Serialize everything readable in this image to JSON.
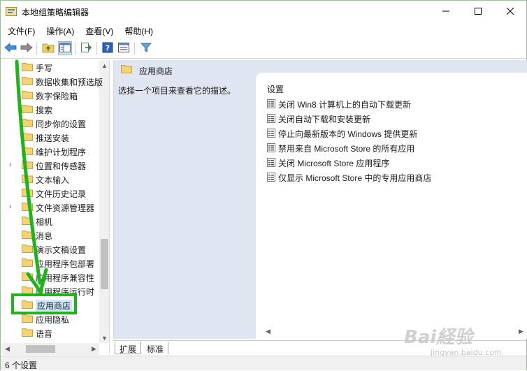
{
  "window": {
    "title": "本地组策略编辑器",
    "controls": {
      "minimize": "minimize-icon",
      "maximize": "maximize-icon",
      "close": "close-icon"
    }
  },
  "menu": [
    "文件(F)",
    "操作(A)",
    "查看(V)",
    "帮助(H)"
  ],
  "toolbar": {
    "icons": [
      "back-arrow-icon",
      "forward-arrow-icon",
      "folder-up-icon",
      "show-hide-tree-icon",
      "export-list-icon",
      "help-icon",
      "properties-icon",
      "filter-icon"
    ]
  },
  "tree": {
    "items": [
      {
        "label": "手写",
        "expandable": false
      },
      {
        "label": "数据收集和预选版",
        "expandable": false
      },
      {
        "label": "数字保险箱",
        "expandable": false
      },
      {
        "label": "搜索",
        "expandable": false
      },
      {
        "label": "同步你的设置",
        "expandable": false
      },
      {
        "label": "推送安装",
        "expandable": false
      },
      {
        "label": "维护计划程序",
        "expandable": false
      },
      {
        "label": "位置和传感器",
        "expandable": true
      },
      {
        "label": "文本输入",
        "expandable": false
      },
      {
        "label": "文件历史记录",
        "expandable": false
      },
      {
        "label": "文件资源管理器",
        "expandable": true
      },
      {
        "label": "相机",
        "expandable": false
      },
      {
        "label": "消息",
        "expandable": false
      },
      {
        "label": "演示文稿设置",
        "expandable": false
      },
      {
        "label": "应用程序包部署",
        "expandable": false
      },
      {
        "label": "应用程序兼容性",
        "expandable": false
      },
      {
        "label": "应用程序运行时",
        "expandable": false
      },
      {
        "label": "应用商店",
        "expandable": false,
        "selected": true
      },
      {
        "label": "应用隐私",
        "expandable": false
      },
      {
        "label": "语音",
        "expandable": false
      }
    ]
  },
  "right": {
    "header": "应用商店",
    "description": "选择一个项目来查看它的描述。",
    "column_header": "设置",
    "settings": [
      "关闭 Win8 计算机上的自动下载更新",
      "关闭自动下载和安装更新",
      "停止向最新版本的 Windows 提供更新",
      "禁用来自 Microsoft Store 的所有应用",
      "关闭 Microsoft Store 应用程序",
      "仅显示 Microsoft Store 中的专用应用商店"
    ]
  },
  "tabs": {
    "extended": "扩展",
    "standard": "标准"
  },
  "status": "6 个设置",
  "annotation": {
    "color": "#22b21d"
  },
  "watermark": {
    "logo": "Bai経验",
    "url": "jingyan.baidu.com"
  }
}
